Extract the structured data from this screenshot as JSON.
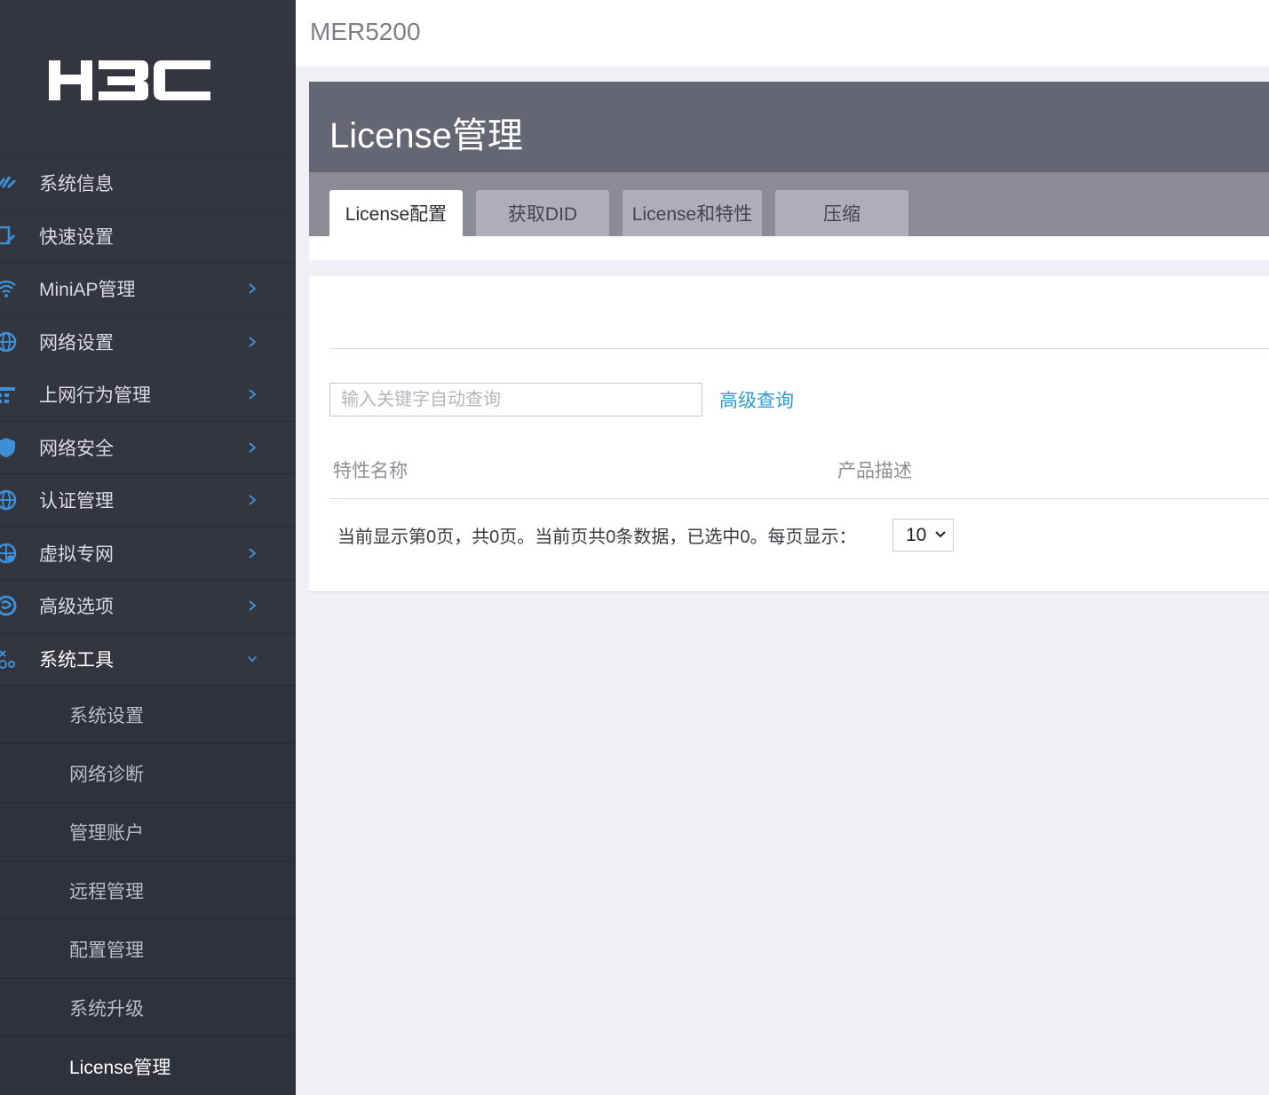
{
  "brand": {
    "logo_text": "H3C",
    "model": "MER5200"
  },
  "sidebar": {
    "items": [
      {
        "label": "系统信息",
        "icon": "dashboard-icon",
        "has_children": false
      },
      {
        "label": "快速设置",
        "icon": "quick-setup-icon",
        "has_children": false
      },
      {
        "label": "MiniAP管理",
        "icon": "wifi-icon",
        "has_children": true
      },
      {
        "label": "网络设置",
        "icon": "globe-icon",
        "has_children": true
      },
      {
        "label": "上网行为管理",
        "icon": "network-behavior-icon",
        "has_children": true
      },
      {
        "label": "网络安全",
        "icon": "shield-icon",
        "has_children": true
      },
      {
        "label": "认证管理",
        "icon": "globe-auth-icon",
        "has_children": true
      },
      {
        "label": "虚拟专网",
        "icon": "vpn-icon",
        "has_children": true
      },
      {
        "label": "高级选项",
        "icon": "advanced-icon",
        "has_children": true
      },
      {
        "label": "系统工具",
        "icon": "tools-icon",
        "has_children": true,
        "expanded": true
      }
    ],
    "sub_items": [
      {
        "label": "系统设置"
      },
      {
        "label": "网络诊断"
      },
      {
        "label": "管理账户"
      },
      {
        "label": "远程管理"
      },
      {
        "label": "配置管理"
      },
      {
        "label": "系统升级"
      },
      {
        "label": "License管理",
        "active": true
      }
    ]
  },
  "page": {
    "title": "License管理",
    "tabs": [
      {
        "label": "License配置",
        "active": true
      },
      {
        "label": "获取DID"
      },
      {
        "label": "License和特性"
      },
      {
        "label": "压缩"
      }
    ]
  },
  "search": {
    "placeholder": "输入关键字自动查询",
    "advanced_label": "高级查询"
  },
  "table": {
    "columns": [
      "特性名称",
      "产品描述"
    ],
    "rows": []
  },
  "pager": {
    "summary": "当前显示第0页，共0页。当前页共0条数据，已选中0。每页显示：",
    "page_size": "10"
  },
  "colors": {
    "sidebar_bg": "#33363f",
    "title_bg": "#646673",
    "tabs_bg": "#8b8c96",
    "link": "#2f9bd1",
    "icon_blue": "#3d8fd8"
  }
}
